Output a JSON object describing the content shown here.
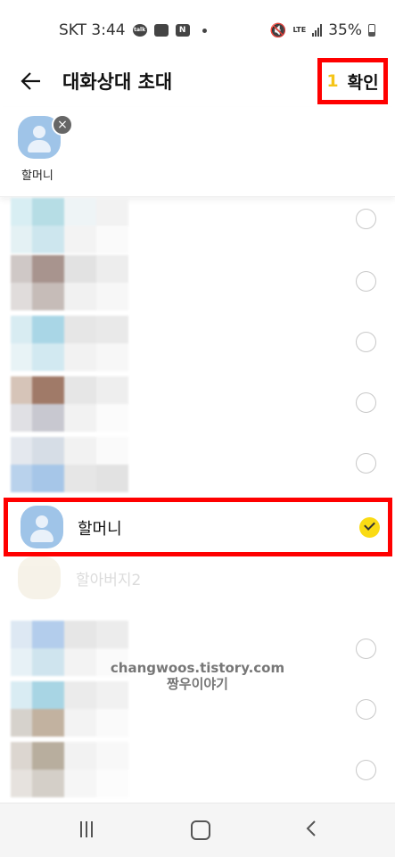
{
  "status": {
    "carrier_time": "SKT 3:44",
    "notif_icons": [
      "talk-icon",
      "gallery-icon",
      "naver-icon"
    ],
    "n_label": "N",
    "talk_label": "talk",
    "lte_label": "LTE",
    "battery": "35%"
  },
  "header": {
    "title": "대화상대 초대",
    "count": "1",
    "confirm_label": "확인"
  },
  "selected": [
    {
      "name": "할머니",
      "remove": "×"
    }
  ],
  "list": {
    "selected_name": "할머니",
    "faded_name": "할아버지2"
  },
  "watermark": {
    "line1": "changwoos.tistory.com",
    "line2": "짱우이야기"
  },
  "colors": {
    "accent_yellow": "#fadb14",
    "highlight_red": "#ff0000",
    "avatar_blue": "#9fc4e8"
  }
}
